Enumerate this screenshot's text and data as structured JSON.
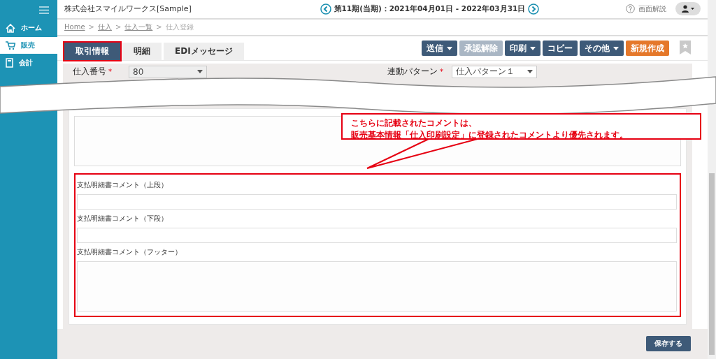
{
  "header": {
    "company": "株式会社スマイルワークス[Sample]",
    "period": "第11期(当期)：2021年04月01日 - 2022年03月31日",
    "help": "画面解説"
  },
  "sidebar": {
    "items": [
      {
        "label": "ホーム",
        "selected": false
      },
      {
        "label": "販売",
        "selected": true
      },
      {
        "label": "会計",
        "selected": false
      }
    ]
  },
  "breadcrumb": [
    {
      "kind": "link",
      "label": "Home"
    },
    {
      "kind": "separator",
      "label": ">"
    },
    {
      "kind": "link",
      "label": "仕入"
    },
    {
      "kind": "separator",
      "label": ">"
    },
    {
      "kind": "link",
      "label": "仕入一覧"
    },
    {
      "kind": "separator",
      "label": ">"
    },
    {
      "kind": "current",
      "label": "仕入登録"
    }
  ],
  "tabs": [
    {
      "label": "取引情報",
      "selected": true,
      "highlighted": true
    },
    {
      "label": "明細",
      "selected": false,
      "highlighted": false
    },
    {
      "label": "EDIメッセージ",
      "selected": false,
      "highlighted": false
    }
  ],
  "actions": [
    {
      "label": "送信",
      "dropdown": true,
      "disabled": false,
      "kind": "normal"
    },
    {
      "label": "承認解除",
      "dropdown": false,
      "disabled": true,
      "kind": "normal"
    },
    {
      "label": "印刷",
      "dropdown": true,
      "disabled": false,
      "kind": "normal"
    },
    {
      "label": "コピー",
      "dropdown": false,
      "disabled": false,
      "kind": "normal"
    },
    {
      "label": "その他",
      "dropdown": true,
      "disabled": false,
      "kind": "normal"
    },
    {
      "label": "新規作成",
      "dropdown": false,
      "disabled": false,
      "kind": "accent"
    }
  ],
  "fields": [
    {
      "label": "仕入番号",
      "required_mark": "*",
      "value": "80"
    },
    {
      "label": "連動パターン",
      "required_mark": "*",
      "value": "仕入パターン１"
    }
  ],
  "comment_group": {
    "highlighted": true,
    "items": [
      {
        "label": "支払明細書コメント（上段）",
        "kind": "input"
      },
      {
        "label": "支払明細書コメント（下段）",
        "kind": "input"
      },
      {
        "label": "支払明細書コメント（フッター）",
        "kind": "textarea"
      }
    ]
  },
  "callout": {
    "lines": [
      "こちらに記載されたコメントは、",
      "販売基本情報「仕入印刷設定」に登録されたコメントより優先されます。"
    ]
  },
  "save_button": "保存する"
}
